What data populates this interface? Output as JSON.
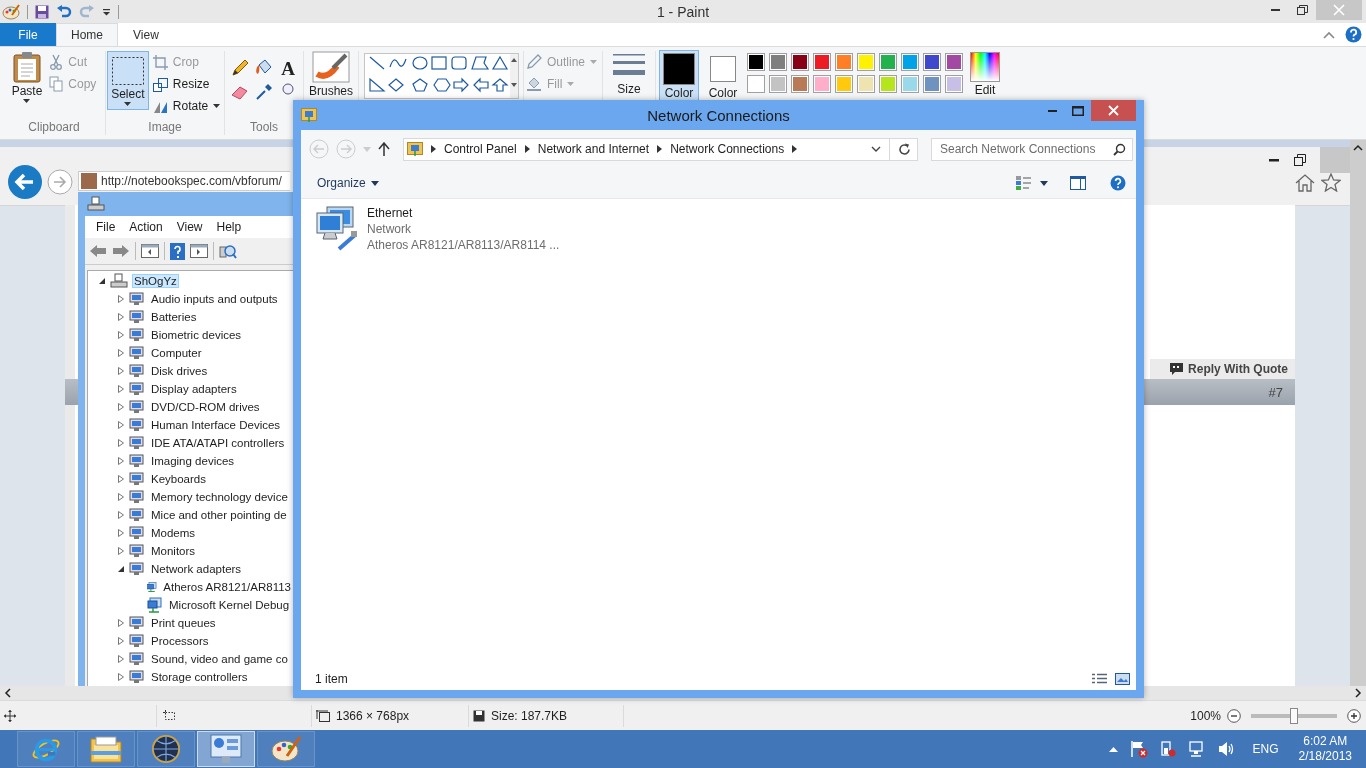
{
  "paint": {
    "title": "1 - Paint",
    "tabs": [
      {
        "label": "File",
        "kind": "file",
        "selected": false
      },
      {
        "label": "Home",
        "kind": "tab",
        "selected": true
      },
      {
        "label": "View",
        "kind": "tab",
        "selected": false
      }
    ],
    "clipboard": {
      "label": "Clipboard",
      "paste": "Paste",
      "actions": [
        {
          "label": "Cut",
          "kind": "cut",
          "disabled": true
        },
        {
          "label": "Copy",
          "kind": "copy",
          "disabled": true
        }
      ]
    },
    "image": {
      "label": "Image",
      "select": {
        "label": "Select",
        "selected": true
      },
      "actions": [
        {
          "label": "Crop",
          "kind": "crop",
          "disabled": true,
          "dropdown": false
        },
        {
          "label": "Resize",
          "kind": "resize",
          "disabled": false,
          "dropdown": false
        },
        {
          "label": "Rotate",
          "kind": "rotate",
          "disabled": false,
          "dropdown": true
        }
      ]
    },
    "tools": {
      "label": "Tools",
      "text_glyph": "A"
    },
    "brushes": "Brushes",
    "shape_styles": [
      {
        "label": "Outline",
        "kind": "outline",
        "disabled": true
      },
      {
        "label": "Fill",
        "kind": "fill",
        "disabled": true
      }
    ],
    "size": "Size",
    "colors": [
      {
        "label": "Color",
        "color": "#000000",
        "selected": true
      },
      {
        "label": "Color",
        "color": "#ffffff",
        "selected": false
      }
    ],
    "palette": [
      {
        "color": "#000000"
      },
      {
        "color": "#7f7f7f"
      },
      {
        "color": "#880015"
      },
      {
        "color": "#ed1c24"
      },
      {
        "color": "#ff7f27"
      },
      {
        "color": "#fff200"
      },
      {
        "color": "#22b14c"
      },
      {
        "color": "#00a2e8"
      },
      {
        "color": "#3f48cc"
      },
      {
        "color": "#a349a4"
      },
      {
        "color": "#ffffff"
      },
      {
        "color": "#c3c3c3"
      },
      {
        "color": "#b97a57"
      },
      {
        "color": "#ffaec9"
      },
      {
        "color": "#ffc90e"
      },
      {
        "color": "#efe4b0"
      },
      {
        "color": "#b5e61d"
      },
      {
        "color": "#99d9ea"
      },
      {
        "color": "#7092be"
      },
      {
        "color": "#c8bfe7"
      }
    ],
    "edit_colors": "Edit",
    "status_bar": {
      "dimensions": "1366 × 768px",
      "file_size": "Size: 187.7KB",
      "zoom": "100%",
      "zoom_slider": {
        "level": 0.5
      }
    }
  },
  "browser": {
    "url": "http://notebookspec.com/vbforum/",
    "reply": "Reply With Quote",
    "post_number": "#7"
  },
  "device_manager": {
    "menu": [
      "File",
      "Action",
      "View",
      "Help"
    ],
    "tree": {
      "label": "ShOgYz",
      "selected": true,
      "expanded": true,
      "children": [
        {
          "label": "Audio inputs and outputs",
          "selected": false,
          "expanded": false
        },
        {
          "label": "Batteries",
          "selected": false,
          "expanded": false
        },
        {
          "label": "Biometric devices",
          "selected": false,
          "expanded": false
        },
        {
          "label": "Computer",
          "selected": false,
          "expanded": false
        },
        {
          "label": "Disk drives",
          "selected": false,
          "expanded": false
        },
        {
          "label": "Display adapters",
          "selected": false,
          "expanded": false
        },
        {
          "label": "DVD/CD-ROM drives",
          "selected": false,
          "expanded": false
        },
        {
          "label": "Human Interface Devices",
          "selected": false,
          "expanded": false
        },
        {
          "label": "IDE ATA/ATAPI controllers",
          "selected": false,
          "expanded": false
        },
        {
          "label": "Imaging devices",
          "selected": false,
          "expanded": false
        },
        {
          "label": "Keyboards",
          "selected": false,
          "expanded": false
        },
        {
          "label": "Memory technology device",
          "selected": false,
          "expanded": false
        },
        {
          "label": "Mice and other pointing de",
          "selected": false,
          "expanded": false
        },
        {
          "label": "Modems",
          "selected": false,
          "expanded": false
        },
        {
          "label": "Monitors",
          "selected": false,
          "expanded": false
        },
        {
          "label": "Network adapters",
          "selected": false,
          "expanded": true,
          "children": [
            {
              "label": "Atheros AR8121/AR8113",
              "selected": false
            },
            {
              "label": "Microsoft Kernel Debug",
              "selected": false
            }
          ]
        },
        {
          "label": "Print queues",
          "selected": false,
          "expanded": false
        },
        {
          "label": "Processors",
          "selected": false,
          "expanded": false
        },
        {
          "label": "Sound, video and game co",
          "selected": false,
          "expanded": false
        },
        {
          "label": "Storage controllers",
          "selected": false,
          "expanded": false
        }
      ]
    }
  },
  "network_connections": {
    "title": "Network Connections",
    "breadcrumb": [
      "Control Panel",
      "Network and Internet",
      "Network Connections"
    ],
    "search": {
      "placeholder": "Search Network Connections"
    },
    "organize": "Organize",
    "items": [
      {
        "name": "Ethernet",
        "type": "Network",
        "device": "Atheros AR8121/AR8113/AR8114 ..."
      }
    ],
    "item_count": "1 item"
  },
  "taskbar": {
    "apps": [
      {
        "kind": "ie",
        "selected": false
      },
      {
        "kind": "explorer",
        "selected": false
      },
      {
        "kind": "globe",
        "selected": false
      },
      {
        "kind": "control-panel",
        "selected": true
      },
      {
        "kind": "paint",
        "selected": false
      }
    ],
    "language": "ENG",
    "time": "6:02 AM",
    "date": "2/18/2013"
  }
}
